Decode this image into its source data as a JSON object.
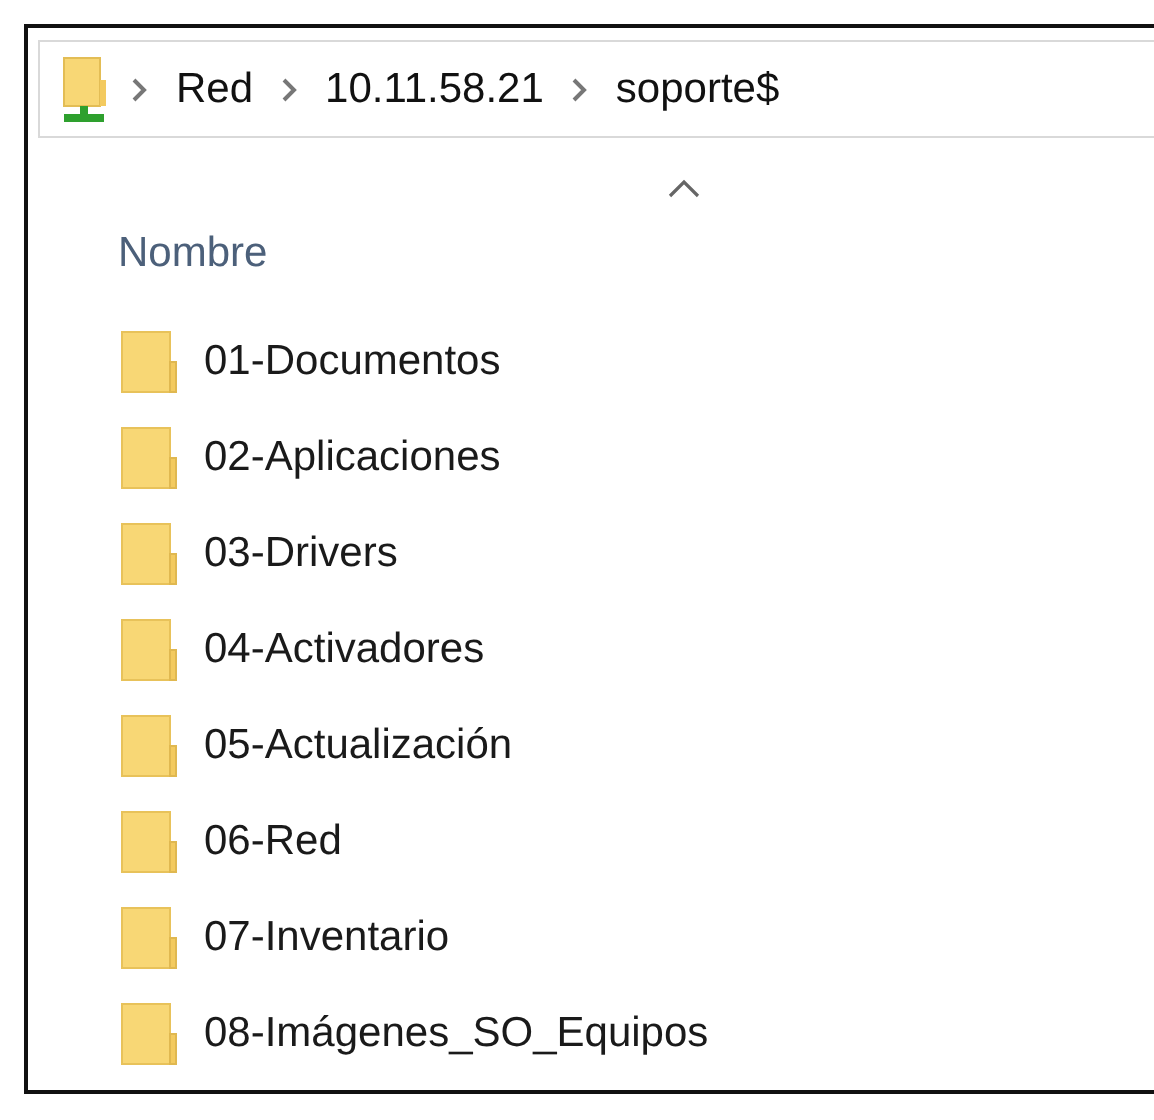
{
  "breadcrumb": [
    "Red",
    "10.11.58.21",
    "soporte$"
  ],
  "column": {
    "label": "Nombre",
    "sort_ascending": true
  },
  "items": [
    {
      "name": "01-Documentos"
    },
    {
      "name": "02-Aplicaciones"
    },
    {
      "name": "03-Drivers"
    },
    {
      "name": "04-Activadores"
    },
    {
      "name": "05-Actualización"
    },
    {
      "name": "06-Red"
    },
    {
      "name": "07-Inventario"
    },
    {
      "name": "08-Imágenes_SO_Equipos"
    }
  ]
}
